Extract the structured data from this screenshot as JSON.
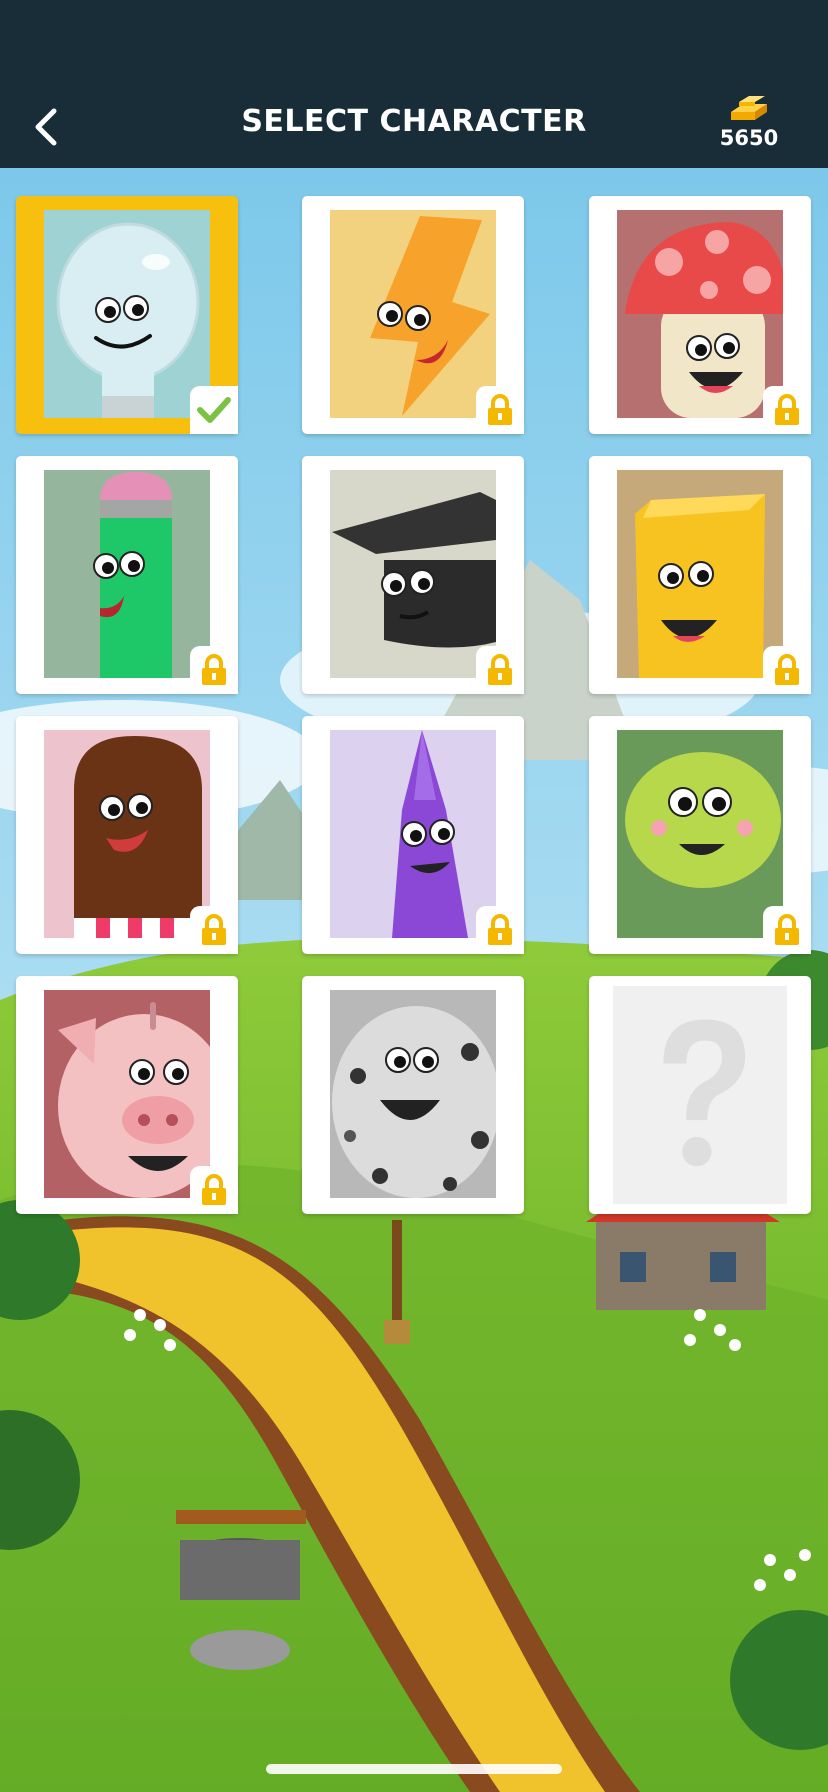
{
  "header": {
    "title": "SELECT CHARACTER",
    "coin_count": "5650",
    "back_icon": "chevron-left-icon",
    "currency_icon": "gold-bars-icon"
  },
  "colors": {
    "header_bg": "#182d38",
    "selected_frame": "#f7c00e",
    "lock": "#f5b800",
    "check": "#7cc242"
  },
  "characters": [
    {
      "name": "lightbulb",
      "status": "selected"
    },
    {
      "name": "lightning-bolt",
      "status": "locked"
    },
    {
      "name": "mushroom",
      "status": "locked"
    },
    {
      "name": "pencil",
      "status": "locked"
    },
    {
      "name": "graduation-cap",
      "status": "locked"
    },
    {
      "name": "gold-bar",
      "status": "locked"
    },
    {
      "name": "chocolate-popsicle",
      "status": "locked"
    },
    {
      "name": "purple-crayon",
      "status": "locked"
    },
    {
      "name": "green-slime",
      "status": "locked"
    },
    {
      "name": "piggy-bank",
      "status": "locked"
    },
    {
      "name": "cookie",
      "status": "locked"
    },
    {
      "name": "mystery",
      "status": "unknown"
    }
  ]
}
